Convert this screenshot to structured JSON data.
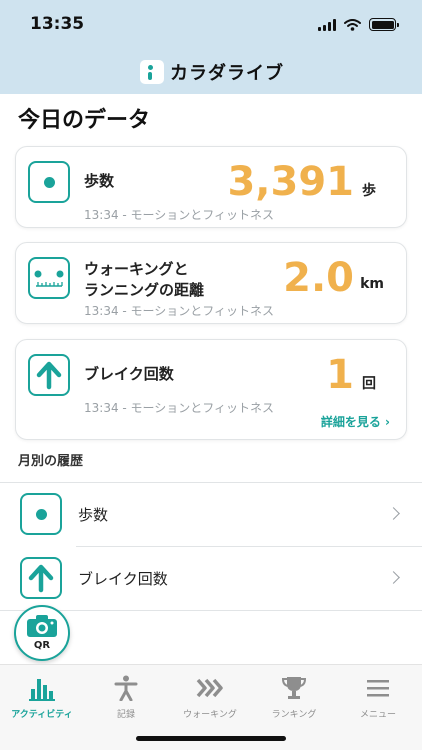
{
  "status_bar": {
    "time": "13:35"
  },
  "header": {
    "app_name": "カラダライブ"
  },
  "page": {
    "title": "今日のデータ"
  },
  "cards": [
    {
      "label": "歩数",
      "value": "3,391",
      "unit": "歩",
      "sub": "13:34 - モーションとフィットネス",
      "icon": "dot-icon"
    },
    {
      "label_line1": "ウォーキングと",
      "label_line2": "ランニングの距離",
      "value": "2.0",
      "unit": "km",
      "sub": "13:34 - モーションとフィットネス",
      "icon": "ruler-icon"
    },
    {
      "label": "ブレイク回数",
      "value": "1",
      "unit": "回",
      "sub": "13:34 - モーションとフィットネス",
      "icon": "arrow-up-icon",
      "link": "詳細を見る ›"
    }
  ],
  "history": {
    "title": "月別の履歴",
    "items": [
      {
        "label": "歩数",
        "icon": "dot-icon"
      },
      {
        "label": "ブレイク回数",
        "icon": "arrow-up-icon"
      }
    ]
  },
  "qr": {
    "label": "QR"
  },
  "tabbar": {
    "items": [
      {
        "label": "アクティビティ",
        "icon": "bar-chart-icon",
        "active": true
      },
      {
        "label": "記録",
        "icon": "person-icon"
      },
      {
        "label": "ウォーキング",
        "icon": "chevrons-icon"
      },
      {
        "label": "ランキング",
        "icon": "trophy-icon"
      },
      {
        "label": "メニュー",
        "icon": "menu-icon"
      }
    ]
  },
  "colors": {
    "accent": "#1aa39a",
    "value": "#f0b14d",
    "header_bg": "#cfe3ef"
  }
}
